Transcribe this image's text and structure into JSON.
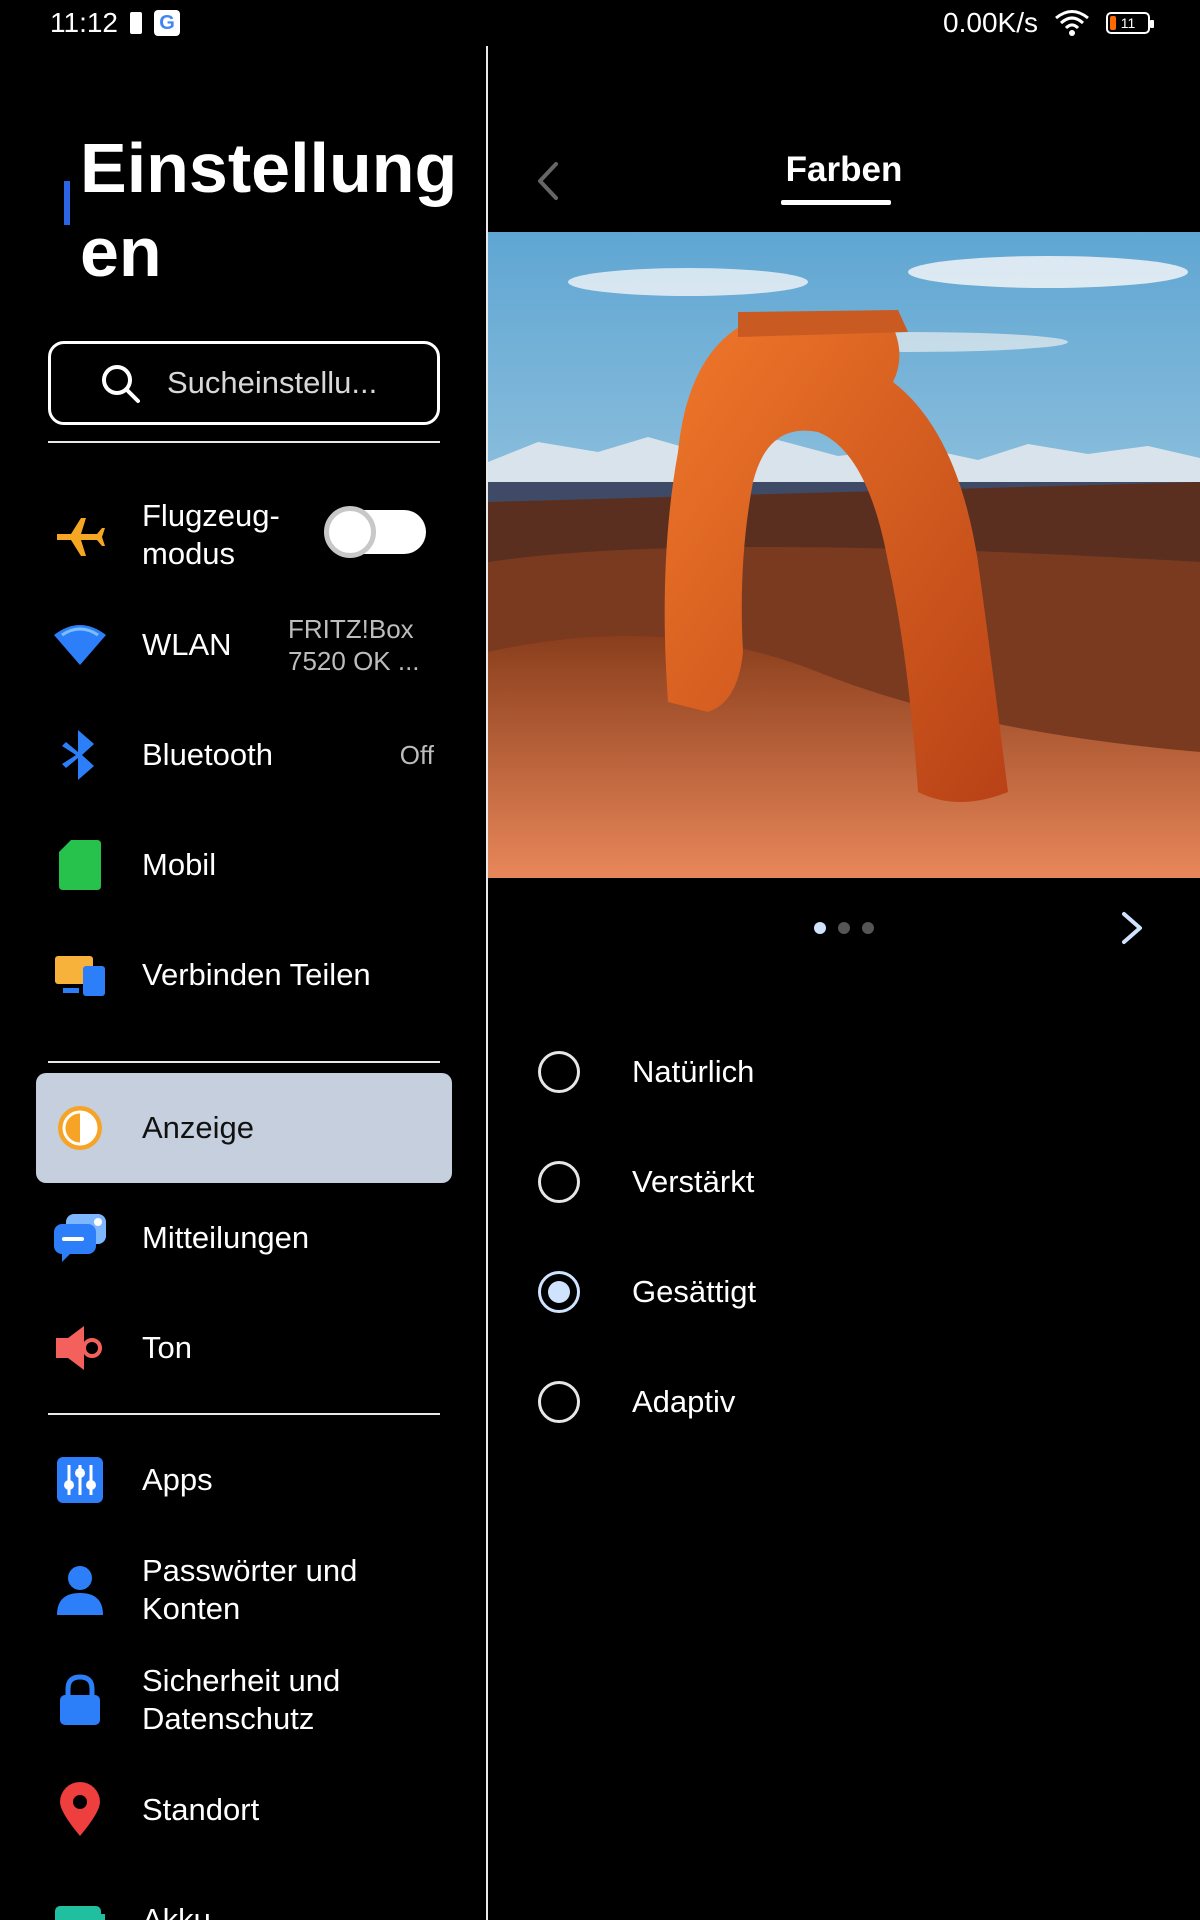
{
  "status_bar": {
    "time": "11:12",
    "g_label": "G",
    "net_speed": "0.00K/s",
    "battery": "11"
  },
  "left": {
    "title": "Einstellungen",
    "search_placeholder": "Sucheinstellu...",
    "items": [
      {
        "label": "Flugzeug-\nmodus",
        "toggle_on": false
      },
      {
        "label": "WLAN",
        "value": "FRITZ!Box 7520 OK ..."
      },
      {
        "label": "Bluetooth",
        "value": "Off"
      },
      {
        "label": "Mobil"
      },
      {
        "label": "Verbinden Teilen"
      },
      {
        "label": "Anzeige",
        "active": true
      },
      {
        "label": "Mitteilungen"
      },
      {
        "label": "Ton"
      },
      {
        "label": "Apps"
      },
      {
        "label": "Passwörter und Konten"
      },
      {
        "label": "Sicherheit und Datenschutz"
      },
      {
        "label": "Standort"
      },
      {
        "label": "Akku"
      }
    ]
  },
  "right": {
    "title": "Farben",
    "carousel": {
      "current": 1,
      "total": 3
    },
    "options": [
      {
        "label": "Natürlich",
        "selected": false
      },
      {
        "label": "Verstärkt",
        "selected": false
      },
      {
        "label": "Gesättigt",
        "selected": true
      },
      {
        "label": "Adaptiv",
        "selected": false
      }
    ]
  },
  "colors": {
    "accent": "#2a65e6",
    "active_item_bg": "#c5cfdd",
    "radio_selected": "#cfe3ff"
  }
}
